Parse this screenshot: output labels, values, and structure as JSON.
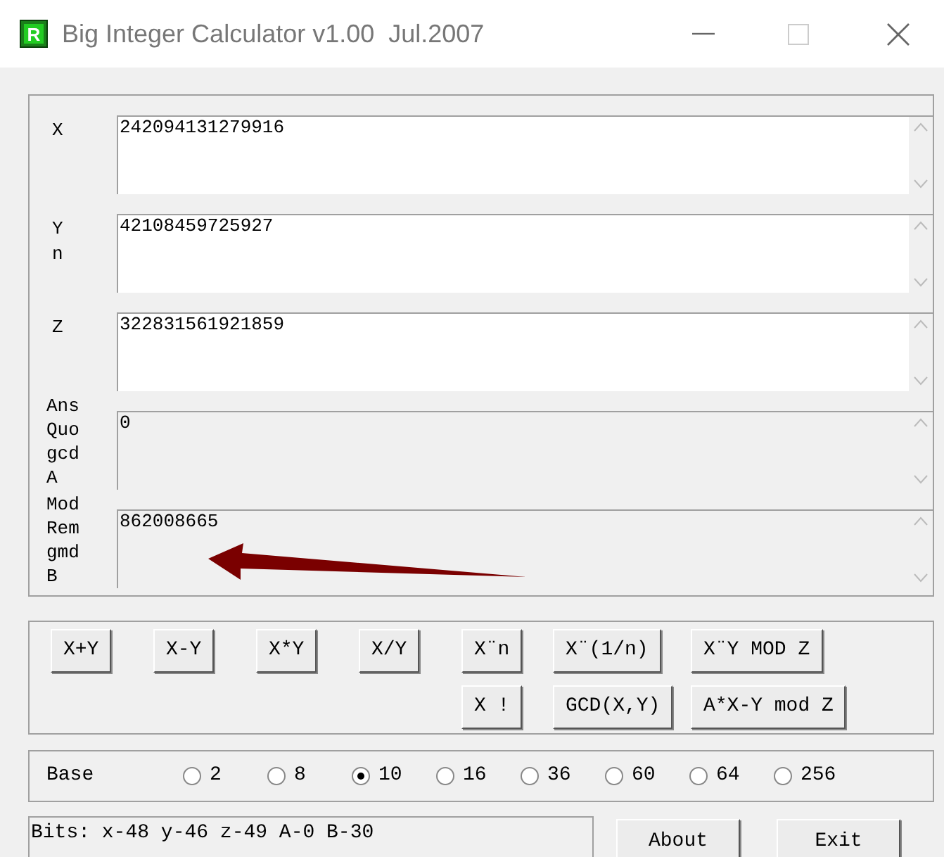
{
  "window": {
    "icon_letter": "R",
    "title": "Big Integer Calculator v1.00  Jul.2007"
  },
  "fields": [
    {
      "kind": "input",
      "label": [
        "X"
      ],
      "value": "242094131279916"
    },
    {
      "kind": "input",
      "label": [
        "Y",
        "n"
      ],
      "value": "42108459725927"
    },
    {
      "kind": "input",
      "label": [
        "Z"
      ],
      "value": "322831561921859"
    },
    {
      "kind": "output",
      "label": [
        "Ans",
        "Quo",
        "gcd",
        "A"
      ],
      "value": "0"
    },
    {
      "kind": "output",
      "label": [
        "Mod",
        "Rem",
        "gmd",
        "B"
      ],
      "value": "862008665"
    }
  ],
  "operations": [
    [
      "X+Y",
      "X-Y",
      "X*Y",
      "X/Y",
      "X¨n",
      "X¨(1/n)",
      "X¨Y MOD Z"
    ],
    [
      "X !",
      "GCD(X,Y)",
      "A*X-Y mod Z"
    ]
  ],
  "base": {
    "label": "Base",
    "options": [
      {
        "label": "2",
        "selected": false
      },
      {
        "label": "8",
        "selected": false
      },
      {
        "label": "10",
        "selected": true
      },
      {
        "label": "16",
        "selected": false
      },
      {
        "label": "36",
        "selected": false
      },
      {
        "label": "60",
        "selected": false
      },
      {
        "label": "64",
        "selected": false
      },
      {
        "label": "256",
        "selected": false
      }
    ]
  },
  "status_bar": "Bits: x-48 y-46 z-49 A-0 B-30",
  "buttons": [
    "About",
    "Exit"
  ]
}
